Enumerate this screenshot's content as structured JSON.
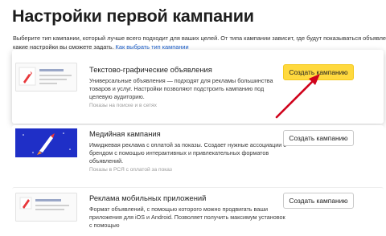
{
  "page": {
    "title": "Настройки первой кампании",
    "intro_line1": "Выберите тип кампании, который лучше всего подходит для ваших целей. От типа кампании зависит, где будут показываться объявления и",
    "intro_line2": "какие настройки вы сможете задать. ",
    "help_link": "Как выбрать тип кампании"
  },
  "campaigns": [
    {
      "title": "Текстово-графические объявления",
      "description": "Универсальные объявления — подходят для рекламы большинства товаров и услуг. Настройки позволяют подстроить кампанию под целевую аудиторию.",
      "placement": "Показы на поиске и в сетях",
      "button": "Создать кампанию"
    },
    {
      "title": "Медийная кампания",
      "description": "Имиджевая реклама с оплатой за показы. Создает нужные ассоциации с брендом с помощью интерактивных и привлекательных форматов объявлений.",
      "placement": "Показы в РСЯ с оплатой за показ",
      "button": "Создать кампанию"
    },
    {
      "title": "Реклама мобильных приложений",
      "description": "Формат объявлений, с помощью которого можно продвигать ваши приложения для iOS и Android. Позволяет получить максимум установок с помощью",
      "placement": "",
      "button": "Создать кампанию"
    }
  ],
  "colors": {
    "primary_button": "#ffd93e",
    "arrow": "#d0021b",
    "link": "#1a5dc8",
    "banner_blue": "#1f2fc7",
    "rocket_red": "#e8373a"
  }
}
